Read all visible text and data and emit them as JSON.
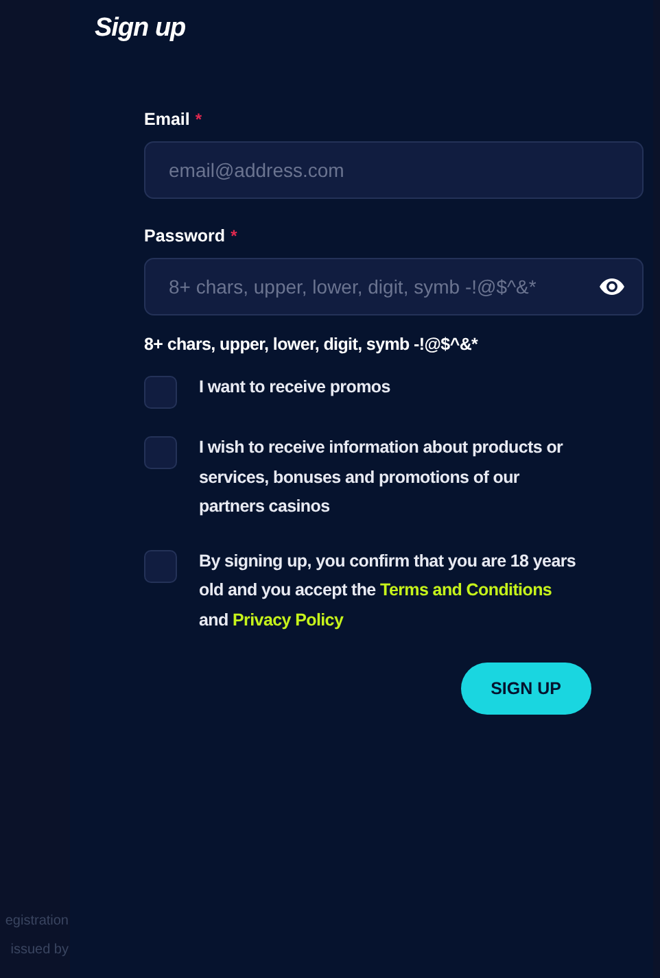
{
  "side_fragments": [
    "egistration",
    "issued by"
  ],
  "title": "Sign up",
  "fields": [
    {
      "label": "Email",
      "required_mark": "*",
      "placeholder": "email@address.com",
      "kind": "text"
    },
    {
      "label": "Password",
      "required_mark": "*",
      "placeholder": "8+ chars, upper, lower, digit, symb -!@$^&*",
      "kind": "password"
    }
  ],
  "password_hint": "8+ chars, upper, lower, digit, symb -!@$^&*",
  "checkboxes": [
    {
      "checked": false,
      "parts": [
        {
          "text": "I want to receive promos",
          "kind": "text"
        }
      ]
    },
    {
      "checked": false,
      "parts": [
        {
          "text": "I wish to receive information about products or services, bonuses and promotions of our partners casinos",
          "kind": "text"
        }
      ]
    },
    {
      "checked": false,
      "parts": [
        {
          "text": "By signing up, you confirm that you are 18 years old and you accept the",
          "kind": "text"
        },
        {
          "text": "Terms and Conditions",
          "kind": "link"
        },
        {
          "text": "and",
          "kind": "text"
        },
        {
          "text": "Privacy Policy",
          "kind": "link"
        }
      ]
    }
  ],
  "submit": "SIGN UP"
}
